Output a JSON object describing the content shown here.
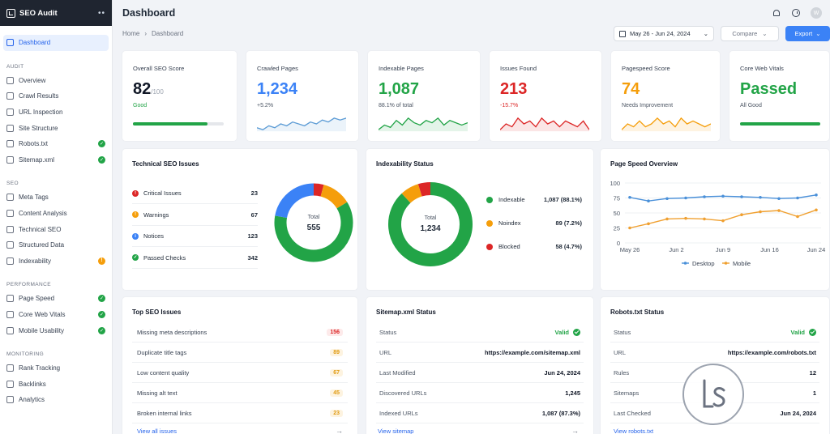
{
  "brand": {
    "title": "SEO Audit"
  },
  "sidebar": {
    "dashboard": "Dashboard",
    "sections": [
      {
        "title": "AUDIT",
        "items": [
          {
            "label": "Overview",
            "badge": ""
          },
          {
            "label": "Crawl Results",
            "badge": ""
          },
          {
            "label": "URL Inspection",
            "badge": ""
          },
          {
            "label": "Site Structure",
            "badge": ""
          },
          {
            "label": "Robots.txt",
            "badge": "ok"
          },
          {
            "label": "Sitemap.xml",
            "badge": "ok"
          }
        ]
      },
      {
        "title": "SEO",
        "items": [
          {
            "label": "Meta Tags",
            "badge": ""
          },
          {
            "label": "Content Analysis",
            "badge": ""
          },
          {
            "label": "Technical SEO",
            "badge": ""
          },
          {
            "label": "Structured Data",
            "badge": ""
          },
          {
            "label": "Indexability",
            "badge": "warn"
          }
        ]
      },
      {
        "title": "PERFORMANCE",
        "items": [
          {
            "label": "Page Speed",
            "badge": "ok"
          },
          {
            "label": "Core Web Vitals",
            "badge": "ok"
          },
          {
            "label": "Mobile Usability",
            "badge": "ok"
          }
        ]
      },
      {
        "title": "MONITORING",
        "items": [
          {
            "label": "Rank Tracking",
            "badge": ""
          },
          {
            "label": "Backlinks",
            "badge": ""
          },
          {
            "label": "Analytics",
            "badge": ""
          }
        ]
      }
    ]
  },
  "header": {
    "title": "Dashboard",
    "avatar": "W"
  },
  "breadcrumb": {
    "home": "Home",
    "sep": "›",
    "current": "Dashboard"
  },
  "toolbar": {
    "date_range": "May 26 - Jun 24, 2024",
    "compare": "Compare",
    "export": "Export"
  },
  "kpis": [
    {
      "label": "Overall SEO Score",
      "value": "82",
      "suffix": "/100",
      "sub": "Good",
      "color": "#111827",
      "sub_color": "#22a447",
      "viz": "bar",
      "progress": 0.82
    },
    {
      "label": "Crawled Pages",
      "value": "1,234",
      "suffix": "",
      "sub": "+5.2%",
      "color": "#3b82f6",
      "sub_color": "#4b5563",
      "viz": "spark",
      "line": "#5b9bd5",
      "spark": [
        6,
        5,
        7,
        6,
        8,
        7,
        9,
        8,
        7,
        9,
        8,
        10,
        9,
        11,
        10,
        11
      ]
    },
    {
      "label": "Indexable Pages",
      "value": "1,087",
      "suffix": "",
      "sub": "88.1% of total",
      "color": "#22a447",
      "sub_color": "#4b5563",
      "viz": "spark",
      "line": "#22a447",
      "spark": [
        4,
        6,
        5,
        8,
        6,
        9,
        7,
        6,
        8,
        7,
        9,
        6,
        8,
        7,
        6,
        7
      ]
    },
    {
      "label": "Issues Found",
      "value": "213",
      "suffix": "",
      "sub": "-15.7%",
      "color": "#dc2626",
      "sub_color": "#dc2626",
      "viz": "spark",
      "line": "#dc2626",
      "spark": [
        5,
        7,
        6,
        9,
        7,
        8,
        6,
        9,
        7,
        8,
        6,
        8,
        7,
        6,
        8,
        5
      ]
    },
    {
      "label": "Pagespeed Score",
      "value": "74",
      "suffix": "",
      "sub": "Needs Improvement",
      "color": "#f59e0b",
      "sub_color": "#4b5563",
      "viz": "spark",
      "line": "#f59e0b",
      "spark": [
        5,
        7,
        6,
        8,
        6,
        7,
        9,
        7,
        8,
        6,
        9,
        7,
        8,
        7,
        6,
        7
      ]
    },
    {
      "label": "Core Web Vitals",
      "value": "Passed",
      "suffix": "",
      "sub": "All Good",
      "color": "#22a447",
      "sub_color": "#4b5563",
      "viz": "bar",
      "progress": 1.0
    }
  ],
  "technical": {
    "title": "Technical SEO Issues",
    "rows": [
      {
        "name": "Critical Issues",
        "count": "23",
        "color": "#dc2626",
        "glyph": "!"
      },
      {
        "name": "Warnings",
        "count": "67",
        "color": "#f59e0b",
        "glyph": "!"
      },
      {
        "name": "Notices",
        "count": "123",
        "color": "#3b82f6",
        "glyph": "i"
      },
      {
        "name": "Passed Checks",
        "count": "342",
        "color": "#22a447",
        "glyph": "✓"
      }
    ],
    "total_label": "Total",
    "total": "555"
  },
  "indexability": {
    "title": "Indexability Status",
    "rows": [
      {
        "name": "Indexable",
        "count": "1,087 (88.1%)",
        "color": "#22a447",
        "value": 1087
      },
      {
        "name": "Noindex",
        "count": "89 (7.2%)",
        "color": "#f59e0b",
        "value": 89
      },
      {
        "name": "Blocked",
        "count": "58 (4.7%)",
        "color": "#dc2626",
        "value": 58
      }
    ],
    "total_label": "Total",
    "total": "1,234"
  },
  "chart_data": {
    "type": "line",
    "title": "Page Speed Overview",
    "categories": [
      "May 26",
      "Jun 2",
      "Jun 9",
      "Jun 16",
      "Jun 24"
    ],
    "ylim": [
      0,
      100
    ],
    "yticks": [
      "100",
      "75",
      "50",
      "25",
      "0"
    ],
    "legend": "bottom",
    "series": [
      {
        "name": "Desktop",
        "color": "#4a90d9",
        "values": [
          76,
          70,
          74,
          75,
          77,
          78,
          77,
          76,
          74,
          75,
          80
        ]
      },
      {
        "name": "Mobile",
        "color": "#f0a030",
        "values": [
          25,
          32,
          40,
          41,
          40,
          37,
          47,
          52,
          54,
          44,
          55
        ]
      }
    ]
  },
  "top_issues": {
    "title": "Top SEO Issues",
    "rows": [
      {
        "name": "Missing meta descriptions",
        "count": "156",
        "color": "#dc2626",
        "bg": "#fdeaea"
      },
      {
        "name": "Duplicate title tags",
        "count": "89",
        "color": "#e09a10",
        "bg": "#fdf3e0"
      },
      {
        "name": "Low content quality",
        "count": "67",
        "color": "#e09a10",
        "bg": "#fdf3e0"
      },
      {
        "name": "Missing alt text",
        "count": "45",
        "color": "#e09a10",
        "bg": "#fdf3e0"
      },
      {
        "name": "Broken internal links",
        "count": "23",
        "color": "#e09a10",
        "bg": "#fdf3e0"
      }
    ],
    "link": "View all issues"
  },
  "sitemap": {
    "title": "Sitemap.xml Status",
    "rows": [
      {
        "k": "Status",
        "v": "Valid",
        "ok": true
      },
      {
        "k": "URL",
        "v": "https://example.com/sitemap.xml",
        "ok": false
      },
      {
        "k": "Last Modified",
        "v": "Jun 24, 2024",
        "ok": false
      },
      {
        "k": "Discovered URLs",
        "v": "1,245",
        "ok": false
      },
      {
        "k": "Indexed URLs",
        "v": "1,087 (87.3%)",
        "ok": false
      }
    ],
    "link": "View sitemap"
  },
  "robots": {
    "title": "Robots.txt Status",
    "rows": [
      {
        "k": "Status",
        "v": "Valid",
        "ok": true
      },
      {
        "k": "URL",
        "v": "https://example.com/robots.txt",
        "ok": false
      },
      {
        "k": "Rules",
        "v": "12",
        "ok": false
      },
      {
        "k": "Sitemaps",
        "v": "1",
        "ok": false
      },
      {
        "k": "Last Checked",
        "v": "Jun 24, 2024",
        "ok": false
      }
    ],
    "link": "View robots.txt"
  },
  "watermark": "Ls"
}
